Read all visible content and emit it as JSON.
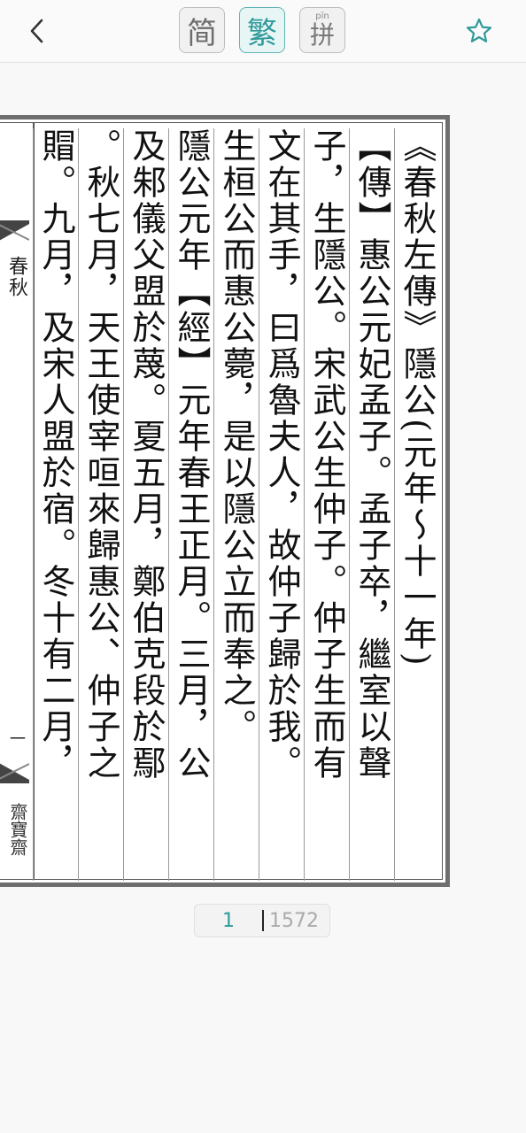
{
  "toolbar": {
    "back_icon": "chevron-left-icon",
    "simplified_label": "简",
    "traditional_label": "繁",
    "pinyin_mark": "pīn",
    "pinyin_char": "拼",
    "active_mode": "traditional",
    "favorite_icon": "star-outline-icon",
    "accent_color": "#2f9a9a"
  },
  "spine": {
    "title": "春秋",
    "page_number": "一",
    "publisher": "齋寶齋"
  },
  "columns": [
    "《春秋左傳》隱公(元年～十一年)",
    "【傳】惠公元妃孟子。孟子卒，繼室以聲",
    "子，生隱公。宋武公生仲子。仲子生而有",
    "文在其手，曰爲魯夫人，故仲子歸於我。",
    "生桓公而惠公薨，是以隱公立而奉之。",
    "隱公元年【經】元年春王正月。三月，公",
    "及邾儀父盟於蔑。夏五月，鄭伯克段於鄢",
    "。秋七月，天王使宰咺來歸惠公、仲子之",
    "賵。九月，及宋人盟於宿。冬十有二月，"
  ],
  "pager": {
    "current": "1",
    "total": "1572"
  }
}
